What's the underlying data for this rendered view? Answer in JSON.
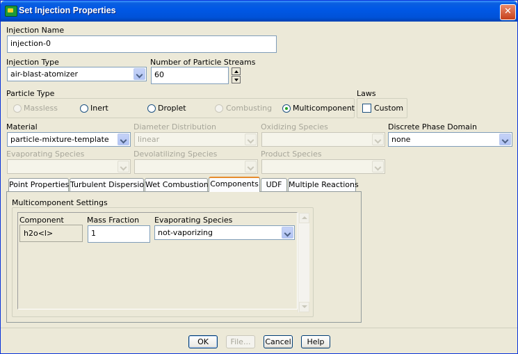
{
  "window": {
    "title": "Set Injection Properties"
  },
  "injection_name": {
    "label": "Injection Name",
    "value": "injection-0"
  },
  "injection_type": {
    "label": "Injection Type",
    "value": "air-blast-atomizer"
  },
  "particle_streams": {
    "label": "Number of Particle Streams",
    "value": "60"
  },
  "particle_type": {
    "label": "Particle Type",
    "options": [
      {
        "label": "Massless",
        "enabled": false,
        "selected": false
      },
      {
        "label": "Inert",
        "enabled": true,
        "selected": false
      },
      {
        "label": "Droplet",
        "enabled": true,
        "selected": false
      },
      {
        "label": "Combusting",
        "enabled": false,
        "selected": false
      },
      {
        "label": "Multicomponent",
        "enabled": true,
        "selected": true
      }
    ]
  },
  "laws": {
    "label": "Laws",
    "custom_label": "Custom",
    "custom_checked": false
  },
  "material": {
    "label": "Material",
    "value": "particle-mixture-template"
  },
  "diameter_distribution": {
    "label": "Diameter Distribution",
    "value": "linear"
  },
  "oxidizing_species": {
    "label": "Oxidizing Species",
    "value": ""
  },
  "discrete_phase_domain": {
    "label": "Discrete Phase Domain",
    "value": "none"
  },
  "evaporating_species": {
    "label": "Evaporating Species",
    "value": ""
  },
  "devolatilizing_species": {
    "label": "Devolatilizing Species",
    "value": ""
  },
  "product_species": {
    "label": "Product Species",
    "value": ""
  },
  "tabs": [
    {
      "label": "Point Properties"
    },
    {
      "label": "Turbulent Dispersion"
    },
    {
      "label": "Wet Combustion"
    },
    {
      "label": "Components"
    },
    {
      "label": "UDF"
    },
    {
      "label": "Multiple Reactions"
    }
  ],
  "active_tab": "Components",
  "multicomponent": {
    "title": "Multicomponent Settings",
    "columns": [
      "Component",
      "Mass Fraction",
      "Evaporating Species"
    ],
    "rows": [
      {
        "component": "h2o<l>",
        "mass_fraction": "1",
        "evaporating_species": "not-vaporizing"
      }
    ]
  },
  "buttons": {
    "ok": "OK",
    "file": "File...",
    "cancel": "Cancel",
    "help": "Help"
  },
  "colors": {
    "titlebar": "#0058e6",
    "dialog_bg": "#ece9d8",
    "active_tab_accent": "#e68b2c",
    "radio_dot": "#21a121"
  }
}
